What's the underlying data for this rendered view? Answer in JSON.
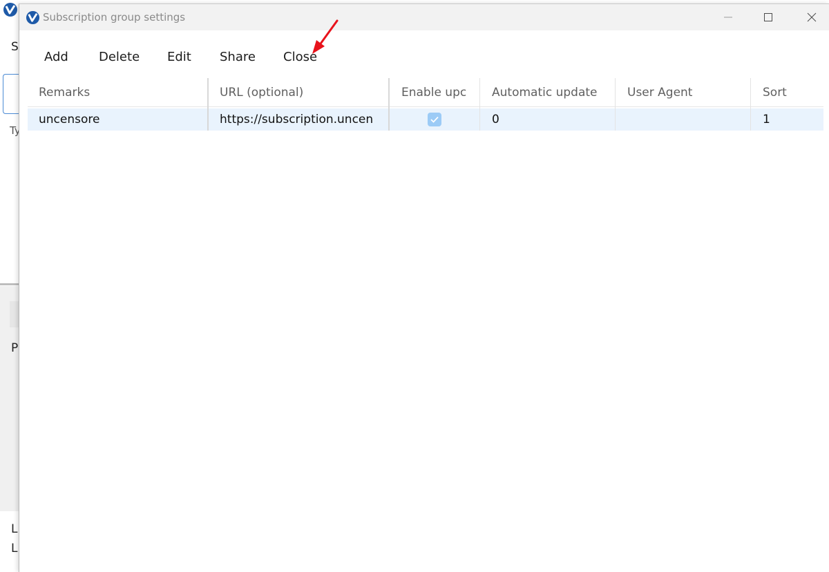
{
  "background_window": {
    "fragments": [
      "S",
      "Ty",
      "P",
      "L",
      "L"
    ]
  },
  "dialog": {
    "title": "Subscription group settings",
    "window_controls": [
      "minimize-icon",
      "maximize-icon",
      "close-icon"
    ]
  },
  "toolbar": {
    "add_label": "Add",
    "delete_label": "Delete",
    "edit_label": "Edit",
    "share_label": "Share",
    "close_label": "Close"
  },
  "grid": {
    "columns": [
      "Remarks",
      "URL (optional)",
      "Enable upc",
      "Automatic update",
      "User Agent",
      "Sort"
    ],
    "rows": [
      {
        "remarks": "uncensore",
        "url": "https://subscription.uncen",
        "enabled": true,
        "automatic_update": "0",
        "user_agent": "",
        "sort": "1"
      }
    ]
  },
  "colors": {
    "selected_row": "#e9f3fd",
    "checkbox": "#9ccbf6",
    "arrow": "#e8121b",
    "accent": "#1e5aa8"
  }
}
